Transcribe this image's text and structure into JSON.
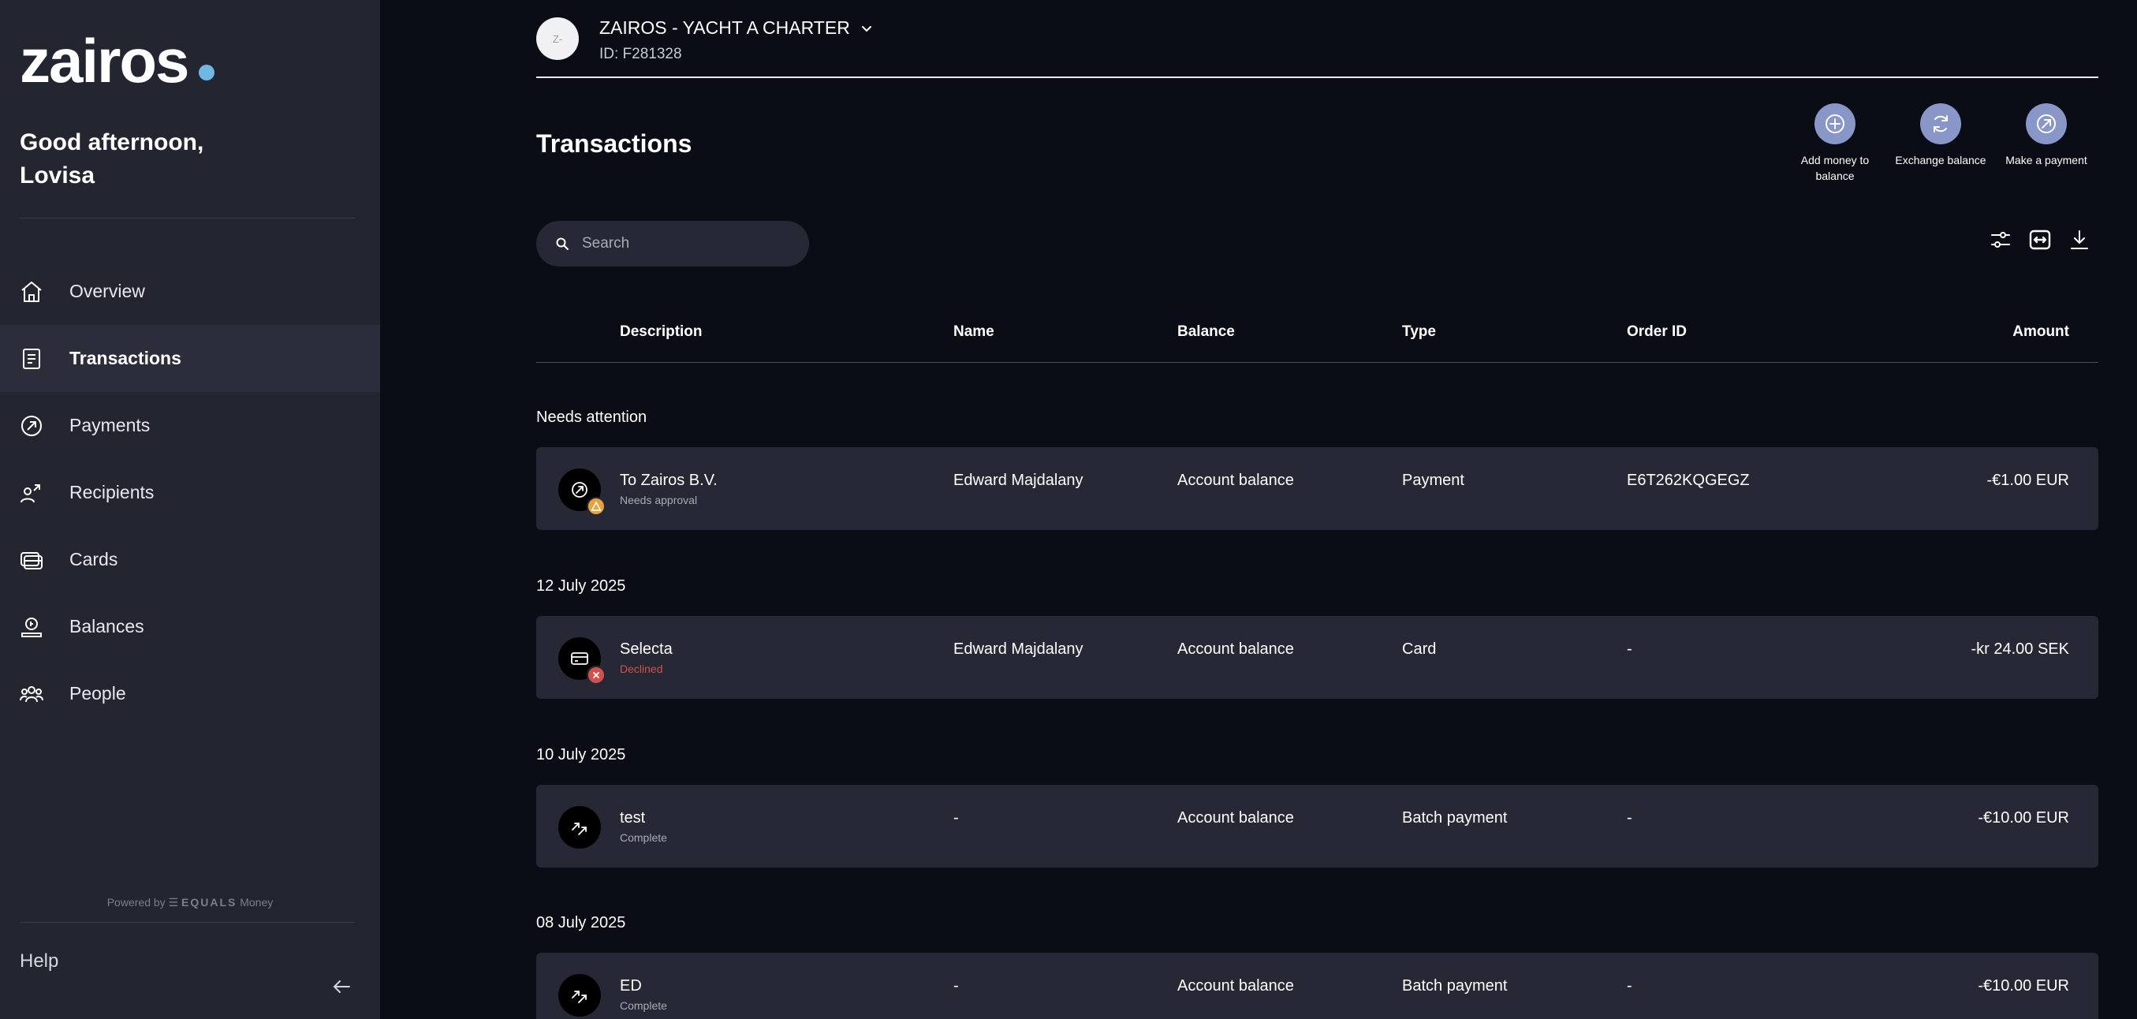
{
  "sidebar": {
    "logo_text": "zairos",
    "greeting_line1": "Good afternoon,",
    "greeting_line2": "Lovisa",
    "nav": [
      {
        "label": "Overview",
        "icon": "home-icon"
      },
      {
        "label": "Transactions",
        "icon": "receipt-icon",
        "active": true
      },
      {
        "label": "Payments",
        "icon": "payment-icon"
      },
      {
        "label": "Recipients",
        "icon": "recipients-icon"
      },
      {
        "label": "Cards",
        "icon": "cards-icon"
      },
      {
        "label": "Balances",
        "icon": "balances-icon"
      },
      {
        "label": "People",
        "icon": "people-icon"
      }
    ],
    "powered_prefix": "Powered by",
    "powered_brand": "EQUALS",
    "powered_suffix": "Money",
    "help_label": "Help"
  },
  "account": {
    "avatar_text": "Z-",
    "name": "ZAIROS - YACHT A CHARTER",
    "id_label": "ID: F281328"
  },
  "page": {
    "title": "Transactions"
  },
  "actions": [
    {
      "label": "Add money to balance",
      "icon": "plus-circle-icon"
    },
    {
      "label": "Exchange balance",
      "icon": "exchange-icon"
    },
    {
      "label": "Make a payment",
      "icon": "send-arrow-icon"
    }
  ],
  "search": {
    "placeholder": "Search",
    "value": ""
  },
  "table": {
    "columns": [
      "Description",
      "Name",
      "Balance",
      "Type",
      "Order ID",
      "Amount"
    ]
  },
  "groups": [
    {
      "label": "Needs attention",
      "rows": [
        {
          "title": "To Zairos B.V.",
          "status": "Needs approval",
          "name": "Edward Majdalany",
          "balance": "Account balance",
          "type": "Payment",
          "order_id": "E6T262KQGEGZ",
          "amount": "-€1.00 EUR"
        }
      ]
    },
    {
      "label": "12 July 2025",
      "rows": [
        {
          "title": "Selecta",
          "status": "Declined",
          "name": "Edward Majdalany",
          "balance": "Account balance",
          "type": "Card",
          "order_id": "-",
          "amount": "-kr 24.00 SEK"
        }
      ]
    },
    {
      "label": "10 July 2025",
      "rows": [
        {
          "title": "test",
          "status": "Complete",
          "name": "-",
          "balance": "Account balance",
          "type": "Batch payment",
          "order_id": "-",
          "amount": "-€10.00 EUR"
        }
      ]
    },
    {
      "label": "08 July 2025",
      "rows": [
        {
          "title": "ED",
          "status": "Complete",
          "name": "-",
          "balance": "Account balance",
          "type": "Batch payment",
          "order_id": "-",
          "amount": "-€10.00 EUR"
        }
      ]
    }
  ],
  "colors": {
    "background": "#0b0d16",
    "sidebar": "#232631",
    "row": "#262935",
    "action_circle": "#8897c7",
    "warning_badge": "#e8a33c",
    "declined_badge": "#d4504a",
    "logo_dot": "#6fb8e4"
  }
}
